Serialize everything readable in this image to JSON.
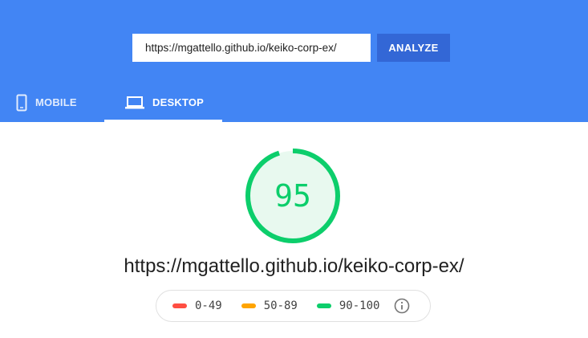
{
  "search": {
    "url_value": "https://mgattello.github.io/keiko-corp-ex/",
    "analyze_label": "ANALYZE"
  },
  "tabs": [
    {
      "label": "MOBILE",
      "icon": "smartphone-icon",
      "active": false
    },
    {
      "label": "DESKTOP",
      "icon": "laptop-icon",
      "active": true
    }
  ],
  "result": {
    "score": "95",
    "score_fraction": 0.95,
    "tested_url": "https://mgattello.github.io/keiko-corp-ex/"
  },
  "legend": [
    {
      "label": "0-49",
      "color": "#ff4e42"
    },
    {
      "label": "50-89",
      "color": "#ffa400"
    },
    {
      "label": "90-100",
      "color": "#0cce6b"
    }
  ],
  "colors": {
    "header": "#4285f4",
    "button": "#3367d6",
    "pass": "#0cce6b",
    "pass_fill": "#e8f9ef"
  }
}
